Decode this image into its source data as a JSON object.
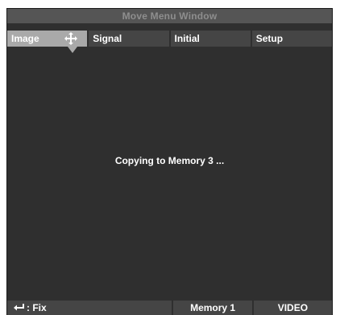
{
  "window": {
    "title": "Move Menu Window"
  },
  "tabs": [
    {
      "label": "Image",
      "active": true
    },
    {
      "label": "Signal",
      "active": false
    },
    {
      "label": "Initial",
      "active": false
    },
    {
      "label": "Setup",
      "active": false
    }
  ],
  "message": "Copying to Memory 3 ...",
  "status": {
    "fix_label": ": Fix",
    "memory": "Memory 1",
    "input": "VIDEO"
  },
  "icons": {
    "move": "move-arrows-icon",
    "enter": "enter-key-icon"
  }
}
